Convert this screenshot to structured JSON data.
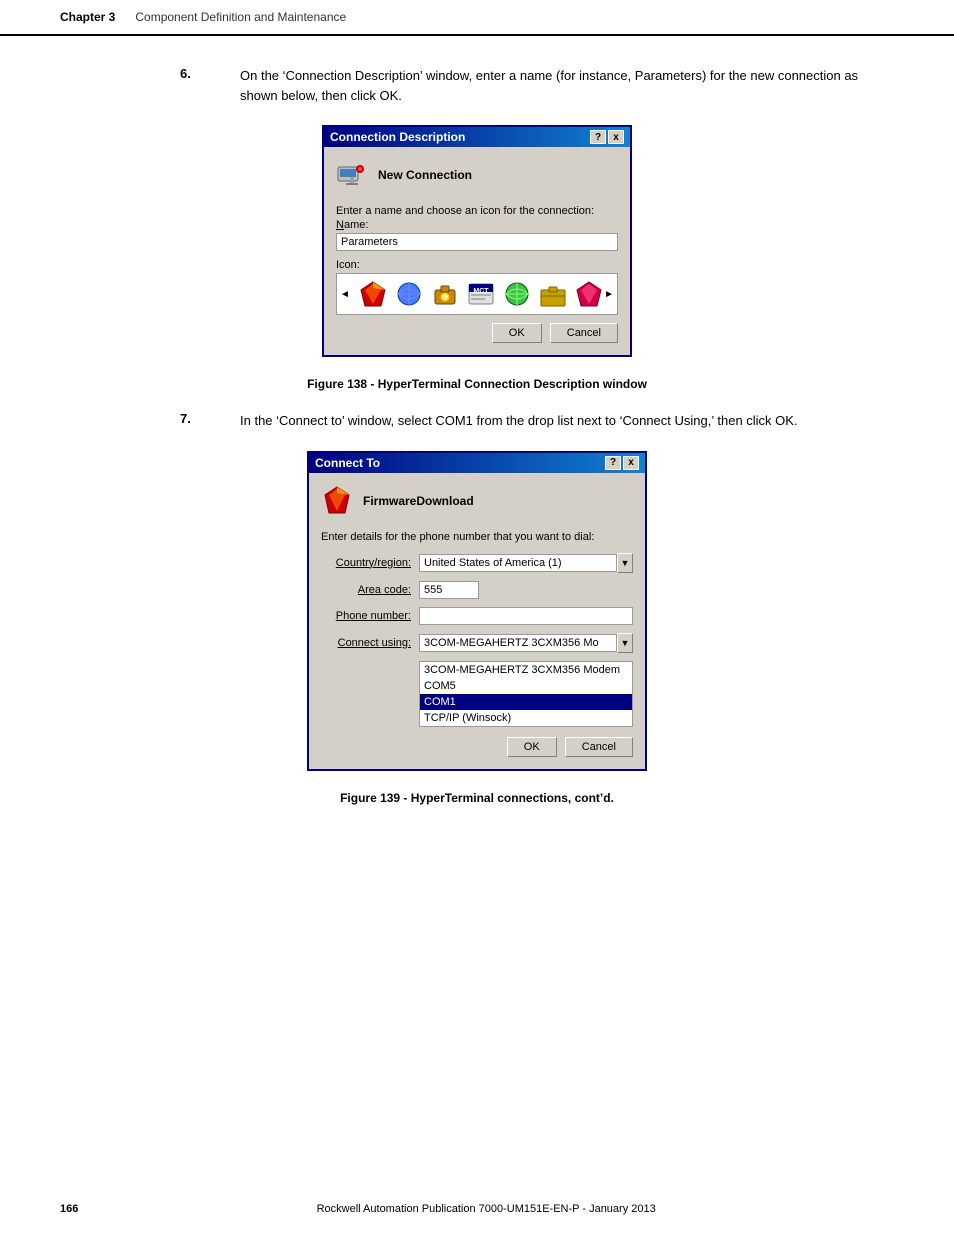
{
  "header": {
    "chapter_label": "Chapter 3",
    "chapter_subtitle": "Component Definition and Maintenance"
  },
  "step6": {
    "number": "6.",
    "text": "On the ‘Connection Description’ window, enter a name (for instance, Parameters) for the new connection as shown below, then click OK."
  },
  "connection_description_dialog": {
    "title": "Connection Description",
    "btn_help": "?",
    "btn_close": "x",
    "icon_alt": "connection-icon",
    "conn_name": "New Connection",
    "prompt": "Enter a name and choose an icon for the connection:",
    "name_label": "Name:",
    "name_value": "Parameters",
    "icon_label": "Icon:",
    "btn_ok": "OK",
    "btn_cancel": "Cancel"
  },
  "figure138": {
    "caption": "Figure 138 -  HyperTerminal Connection Description window"
  },
  "step7": {
    "number": "7.",
    "text": "In the ‘Connect to’ window, select COM1 from the drop list next to ‘Connect Using,’ then click OK."
  },
  "connect_to_dialog": {
    "title": "Connect To",
    "btn_help": "?",
    "btn_close": "x",
    "conn_name": "FirmwareDownload",
    "prompt": "Enter details for the phone number that you want to dial:",
    "country_label": "Country/region:",
    "country_value": "United States of America (1)",
    "area_label": "Area code:",
    "area_value": "555",
    "phone_label": "Phone number:",
    "phone_value": "",
    "connect_label": "Connect using:",
    "connect_value": "3COM-MEGAHERTZ 3CXM356 Mo",
    "dropdown_items": [
      {
        "label": "3COM-MEGAHERTZ 3CXM356 Modem",
        "selected": false
      },
      {
        "label": "COM5",
        "selected": false
      },
      {
        "label": "COM1",
        "selected": true
      },
      {
        "label": "TCP/IP (Winsock)",
        "selected": false
      }
    ],
    "btn_ok": "OK",
    "btn_cancel": "Cancel"
  },
  "figure139": {
    "caption": "Figure 139 - HyperTerminal connections, cont’d."
  },
  "footer": {
    "page_num": "166",
    "publication": "Rockwell Automation Publication 7000-UM151E-EN-P - January 2013"
  }
}
